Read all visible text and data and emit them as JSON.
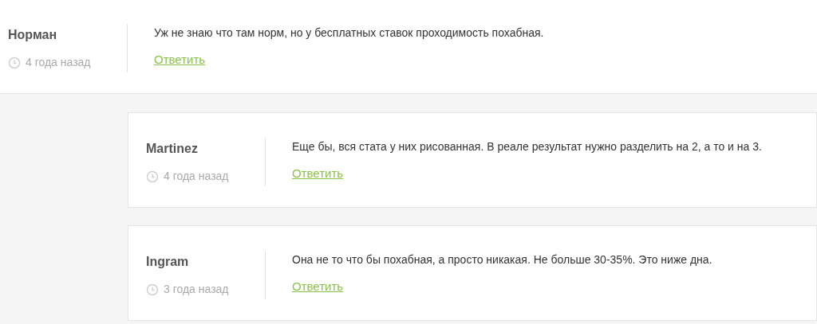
{
  "comments": [
    {
      "author": "Норман",
      "time": "4 года назад",
      "text": "Уж не знаю что там норм, но у бесплатных ставок проходимость похабная.",
      "reply": "Ответить",
      "replies": [
        {
          "author": "Martinez",
          "time": "4 года назад",
          "text": "Еще бы, вся стата у них рисованная. В реале результат нужно разделить на 2, а то и на 3.",
          "reply": "Ответить"
        },
        {
          "author": "Ingram",
          "time": "3 года назад",
          "text": "Она не то что бы похабная, а просто никакая. Не больше 30-35%. Это ниже дна.",
          "reply": "Ответить"
        }
      ]
    }
  ]
}
